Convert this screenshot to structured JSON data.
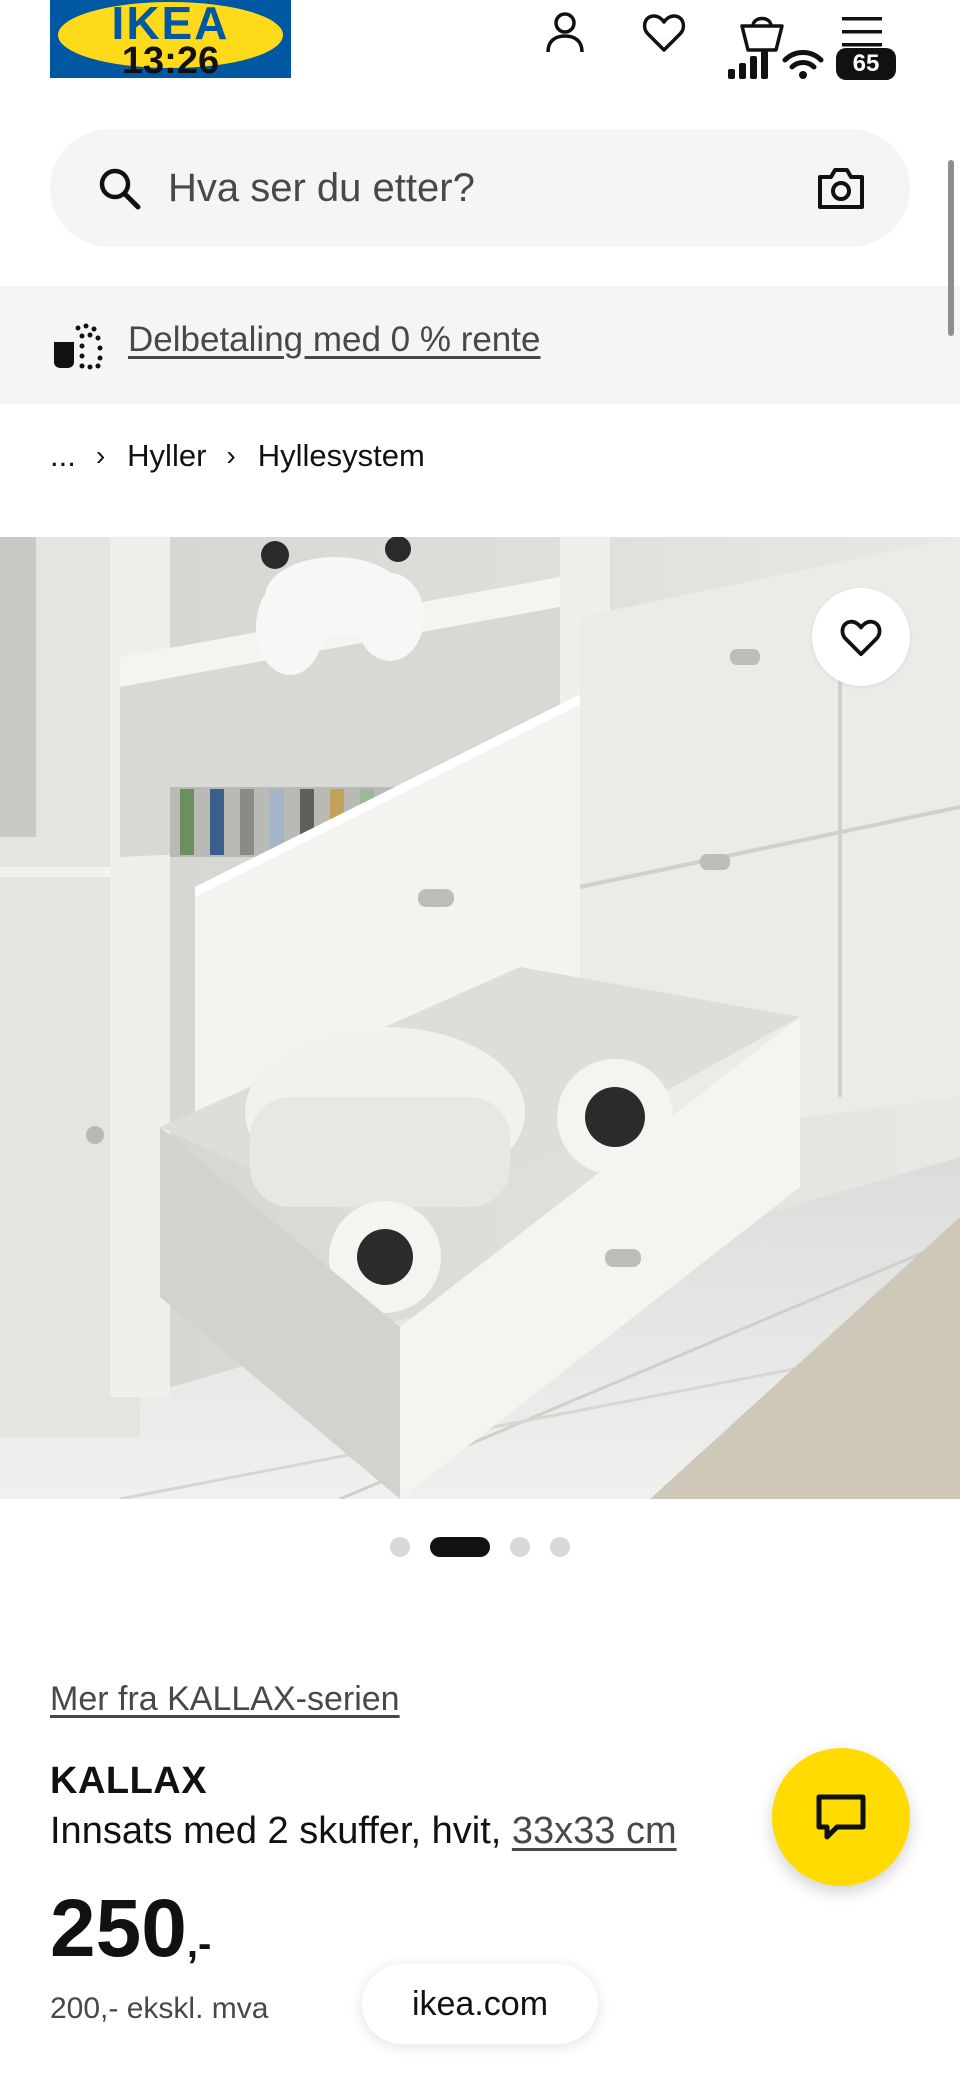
{
  "status_bar": {
    "time": "13:26",
    "battery": "65"
  },
  "header": {
    "logo_text": "IKEA",
    "icons": [
      "profile-icon",
      "heart-icon",
      "shopping-bag-icon",
      "menu-icon"
    ]
  },
  "search": {
    "placeholder": "Hva ser du etter?"
  },
  "banner": {
    "link_text": "Delbetaling med 0 % rente"
  },
  "breadcrumb": {
    "ellipsis": "...",
    "items": [
      "Hyller",
      "Hyllesystem"
    ]
  },
  "carousel": {
    "total": 4,
    "active_index": 1
  },
  "product": {
    "series_link": "Mer fra KALLAX-serien",
    "name": "KALLAX",
    "description": "Innsats med 2 skuffer, hvit,",
    "size_link": "33x33 cm",
    "price": "250",
    "price_suffix": ",-",
    "price_ex_vat": "200,- ekskl. mva"
  },
  "browser": {
    "url": "ikea.com"
  },
  "colors": {
    "ikea_blue": "#0058a3",
    "ikea_yellow": "#ffda1a",
    "chat_yellow": "#ffdb00",
    "text": "#111111",
    "muted": "#484848",
    "surface": "#f5f5f5"
  }
}
